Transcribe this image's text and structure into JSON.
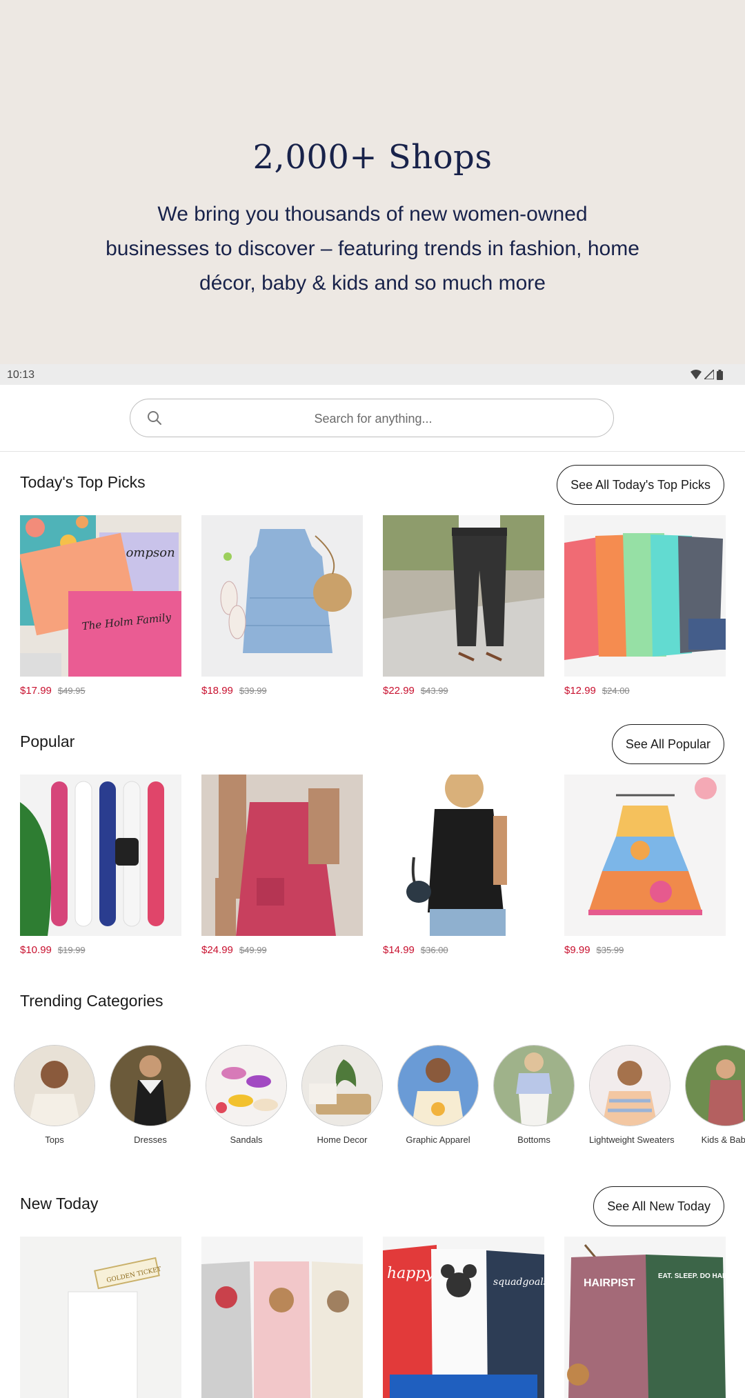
{
  "hero": {
    "title": "2,000+ Shops",
    "description": "We bring you thousands of new women-owned businesses to discover – featuring trends in fashion, home décor, baby & kids and so much more"
  },
  "status": {
    "time": "10:13"
  },
  "search": {
    "placeholder": "Search for anything..."
  },
  "sections": {
    "top_picks": {
      "title": "Today's Top Picks",
      "see_all": "See All Today's Top Picks",
      "products": [
        {
          "price": "$17.99",
          "old_price": "$49.95"
        },
        {
          "price": "$18.99",
          "old_price": "$39.99"
        },
        {
          "price": "$22.99",
          "old_price": "$43.99"
        },
        {
          "price": "$12.99",
          "old_price": "$24.00"
        }
      ]
    },
    "popular": {
      "title": "Popular",
      "see_all": "See All Popular",
      "products": [
        {
          "price": "$10.99",
          "old_price": "$19.99"
        },
        {
          "price": "$24.99",
          "old_price": "$49.99"
        },
        {
          "price": "$14.99",
          "old_price": "$36.00"
        },
        {
          "price": "$9.99",
          "old_price": "$35.99"
        }
      ]
    },
    "trending": {
      "title": "Trending Categories",
      "categories": [
        "Tops",
        "Dresses",
        "Sandals",
        "Home Decor",
        "Graphic Apparel",
        "Bottoms",
        "Lightweight Sweaters",
        "Kids & Baby"
      ]
    },
    "new_today": {
      "title": "New Today",
      "see_all": "See All New Today"
    }
  },
  "image_text": {
    "envelope_name": "Thompson",
    "envelope_family": "The Holm Family",
    "golden_ticket": "GOLDEN TICKET",
    "tee_happy": "happy.",
    "tee_squadgoals": "squadgoals",
    "tee_hairpist": "HAIRPIST",
    "tee_eat_sleep": "EAT. SLEEP. DO HAIR. REPEAT."
  },
  "colors": {
    "hero_bg": "#ede8e3",
    "hero_text": "#18224a",
    "sale_price": "#c8102e",
    "old_price": "#888888"
  }
}
